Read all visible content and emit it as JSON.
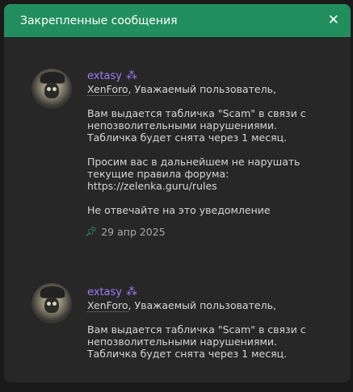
{
  "dialog": {
    "title": "Закрепленные сообщения",
    "close_icon": "close-icon",
    "colors": {
      "header": "#228e5d",
      "username": "#9a7cf5",
      "pin": "#2eb272"
    }
  },
  "messages": [
    {
      "username": "extasy",
      "badge_icon": "sparkle-badge-icon",
      "forum": "XenForo",
      "greeting": ", Уважаемый пользователь,",
      "line1": "Вам выдается табличка \"Scam\" в связи с",
      "line2": "непозволительными нарушениями.",
      "line3": "Табличка будет снята через 1 месяц.",
      "line4": "Просим вас в дальнейшем не нарушать",
      "line5": "текущие правила форума:",
      "line6": "https://zelenka.guru/rules",
      "line7": "Не отвечайте на это уведомление",
      "date": "29 апр 2025"
    },
    {
      "username": "extasy",
      "badge_icon": "sparkle-badge-icon",
      "forum": "XenForo",
      "greeting": ", Уважаемый пользователь,",
      "line1": "Вам выдается табличка \"Scam\" в связи с",
      "line2": "непозволительными нарушениями.",
      "line3": "Табличка будет снята через 1 месяц."
    }
  ]
}
